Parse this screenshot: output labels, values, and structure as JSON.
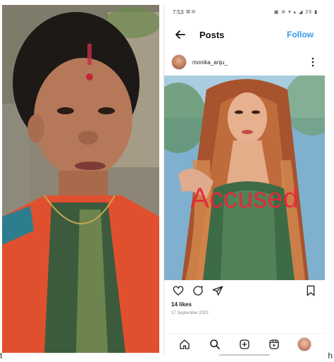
{
  "status_bar": {
    "time": "7:53",
    "left_glyphs": "⌘✉",
    "right_glyphs": "▣ ⊚ ▾ ▴ ◢ 26",
    "battery": "▮"
  },
  "header": {
    "back_icon": "arrow-left-icon",
    "title": "Posts",
    "follow_label": "Follow"
  },
  "post": {
    "username": "monika_anju_",
    "more_icon": "more-vertical-icon",
    "overlay_text": "Accused",
    "likes": "14 likes",
    "date": "17 September 2023"
  },
  "actions": {
    "like_icon": "heart-icon",
    "comment_icon": "comment-icon",
    "share_icon": "send-icon",
    "save_icon": "bookmark-icon"
  },
  "bottom_nav": {
    "items": [
      "home-icon",
      "search-icon",
      "add-icon",
      "reels-icon",
      "profile-avatar"
    ]
  },
  "cut_text": {
    "left": "t",
    "right": "h"
  },
  "colors": {
    "accent": "#3897f0",
    "overlay_red": "#e8263a"
  }
}
